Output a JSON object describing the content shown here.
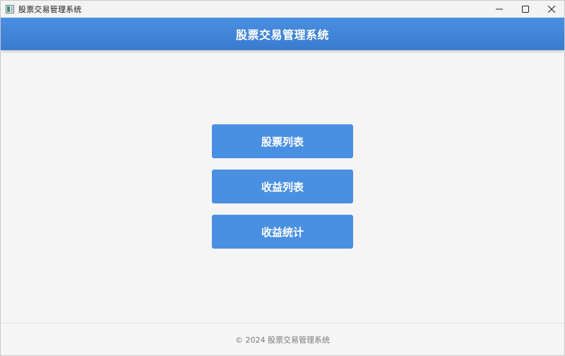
{
  "window": {
    "title": "股票交易管理系统",
    "icon": "app-window-icon",
    "controls": [
      "minimize-icon",
      "maximize-icon",
      "close-icon"
    ]
  },
  "header": {
    "title": "股票交易管理系统",
    "background_color": "#4a8fe0"
  },
  "menu": {
    "buttons": [
      {
        "label": "股票列表"
      },
      {
        "label": "收益列表"
      },
      {
        "label": "收益统计"
      }
    ],
    "button_color": "#4a90e2"
  },
  "footer": {
    "text": "© 2024 股票交易管理系统"
  }
}
